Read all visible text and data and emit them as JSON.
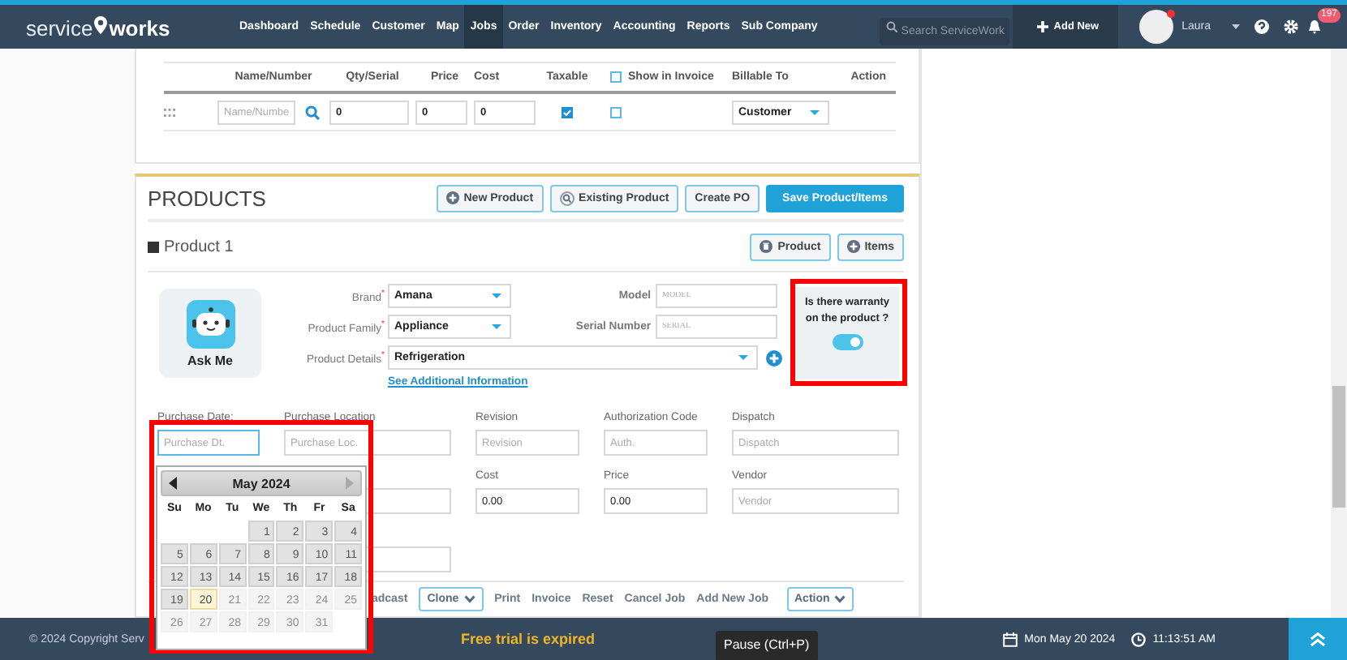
{
  "nav": {
    "logo_left": "service",
    "logo_right": "works",
    "items": [
      {
        "label": "Dashboard",
        "selected": false
      },
      {
        "label": "Schedule",
        "selected": false
      },
      {
        "label": "Customer",
        "selected": false
      },
      {
        "label": "Map",
        "selected": false
      },
      {
        "label": "Jobs",
        "selected": true
      },
      {
        "label": "Order",
        "selected": false
      },
      {
        "label": "Inventory",
        "selected": false
      },
      {
        "label": "Accounting",
        "selected": false
      },
      {
        "label": "Reports",
        "selected": false
      },
      {
        "label": "Sub Company",
        "selected": false
      }
    ],
    "search_placeholder": "Search ServiceWork",
    "add_new": "Add New",
    "user": "Laura",
    "notification_count": "197"
  },
  "items_table": {
    "columns": [
      "Name/Number",
      "Qty/Serial",
      "Price",
      "Cost",
      "Taxable",
      "Show in Invoice",
      "Billable To",
      "Action"
    ],
    "show_in_invoice_checked": false,
    "row": {
      "name_placeholder": "Name/Numbe",
      "qty": "0",
      "price": "0",
      "cost": "0",
      "taxable": true,
      "show_in_invoice": false,
      "billable_to": "Customer"
    }
  },
  "products": {
    "title": "PRODUCTS",
    "buttons": [
      {
        "label": "New Product",
        "kind": "plus"
      },
      {
        "label": "Existing Product",
        "kind": "search"
      },
      {
        "label": "Create PO",
        "kind": "plain"
      },
      {
        "label": "Save Product/Items",
        "kind": "primary"
      }
    ],
    "product": {
      "title": "Product 1",
      "expanded": true,
      "buttons": [
        {
          "label": "Product",
          "kind": "trash"
        },
        {
          "label": "Items",
          "kind": "plus"
        }
      ],
      "ask_me": "Ask Me",
      "brand": {
        "label": "Brand$^{*}$",
        "value": "Amana"
      },
      "model": {
        "label": "Model",
        "placeholder": "MODEL"
      },
      "family": {
        "label": "Product Family$^{*}$",
        "value": "Appliance"
      },
      "serial": {
        "label": "Serial Number",
        "placeholder": "SERIAL"
      },
      "details": {
        "label": "Product Details$^{*}$",
        "value": "Refrigeration"
      },
      "link": "See Additional Information",
      "warranty": {
        "question": "Is there warranty on the product ?",
        "on": true
      },
      "fields": [
        [
          {
            "kind": "field",
            "label": "Purchase Date:",
            "placeholder": "Purchase Dt.",
            "focused": true
          },
          {
            "kind": "field",
            "label": "Purchase Location",
            "placeholder": "Purchase Loc.",
            "focused": false
          },
          {
            "kind": "field",
            "label": "Revision",
            "placeholder": "Revision",
            "focused": false
          },
          {
            "kind": "field",
            "label": "Authorization Code",
            "placeholder": "Auth.",
            "focused": false
          },
          {
            "kind": "field",
            "label": "Dispatch",
            "placeholder": "Dispatch",
            "focused": false
          }
        ],
        [
          {
            "kind": "blank"
          },
          {
            "kind": "blank"
          },
          {
            "kind": "field",
            "label": "Cost",
            "value": "0.00",
            "focused": false
          },
          {
            "kind": "field",
            "label": "Price",
            "value": "0.00",
            "focused": false
          },
          {
            "kind": "field",
            "label": "Vendor",
            "placeholder": "Vendor",
            "focused": false
          }
        ],
        [
          {
            "kind": "blank"
          },
          {
            "kind": "blank"
          }
        ]
      ]
    },
    "actions": [
      {
        "label": "adcast",
        "kind": "link"
      },
      {
        "label": "Clone",
        "kind": "menu"
      },
      {
        "label": "Print",
        "kind": "link"
      },
      {
        "label": "Invoice",
        "kind": "link"
      },
      {
        "label": "Reset",
        "kind": "link"
      },
      {
        "label": "Cancel Job",
        "kind": "link"
      },
      {
        "label": "Add New Job",
        "kind": "link"
      },
      {
        "label": "Action",
        "kind": "menu"
      }
    ]
  },
  "calendar": {
    "month": "May 2024",
    "weekdays": [
      "Su",
      "Mo",
      "Tu",
      "We",
      "Th",
      "Fr",
      "Sa"
    ],
    "weeks": [
      [
        {
          "day": "1",
          "disabled": false,
          "today": false
        },
        {
          "day": "2",
          "disabled": false,
          "today": false
        },
        {
          "day": "3",
          "disabled": false,
          "today": false
        },
        {
          "day": "4",
          "disabled": false,
          "today": false
        }
      ],
      [
        {
          "day": "5",
          "disabled": false,
          "today": false
        },
        {
          "day": "6",
          "disabled": false,
          "today": false
        },
        {
          "day": "7",
          "disabled": false,
          "today": false
        },
        {
          "day": "8",
          "disabled": false,
          "today": false
        },
        {
          "day": "9",
          "disabled": false,
          "today": false
        },
        {
          "day": "10",
          "disabled": false,
          "today": false
        },
        {
          "day": "11",
          "disabled": false,
          "today": false
        }
      ],
      [
        {
          "day": "12",
          "disabled": false,
          "today": false
        },
        {
          "day": "13",
          "disabled": false,
          "today": false
        },
        {
          "day": "14",
          "disabled": false,
          "today": false
        },
        {
          "day": "15",
          "disabled": false,
          "today": false
        },
        {
          "day": "16",
          "disabled": false,
          "today": false
        },
        {
          "day": "17",
          "disabled": false,
          "today": false
        },
        {
          "day": "18",
          "disabled": false,
          "today": false
        }
      ],
      [
        {
          "day": "19",
          "disabled": false,
          "today": false
        },
        {
          "day": "20",
          "disabled": false,
          "today": true
        },
        {
          "day": "21",
          "disabled": true,
          "today": false
        },
        {
          "day": "22",
          "disabled": true,
          "today": false
        },
        {
          "day": "23",
          "disabled": true,
          "today": false
        },
        {
          "day": "24",
          "disabled": true,
          "today": false
        },
        {
          "day": "25",
          "disabled": true,
          "today": false
        }
      ],
      [
        {
          "day": "26",
          "disabled": true,
          "today": false
        },
        {
          "day": "27",
          "disabled": true,
          "today": false
        },
        {
          "day": "28",
          "disabled": true,
          "today": false
        },
        {
          "day": "29",
          "disabled": true,
          "today": false
        },
        {
          "day": "30",
          "disabled": true,
          "today": false
        },
        {
          "day": "31",
          "disabled": true,
          "today": false
        }
      ]
    ]
  },
  "footer": {
    "copyright": "© 2024 Copyright Serv",
    "notice": "Free trial is expired",
    "date": "Mon May 20 2024",
    "time": "11:13:51 AM"
  },
  "tooltip": "Pause (Ctrl+P)"
}
